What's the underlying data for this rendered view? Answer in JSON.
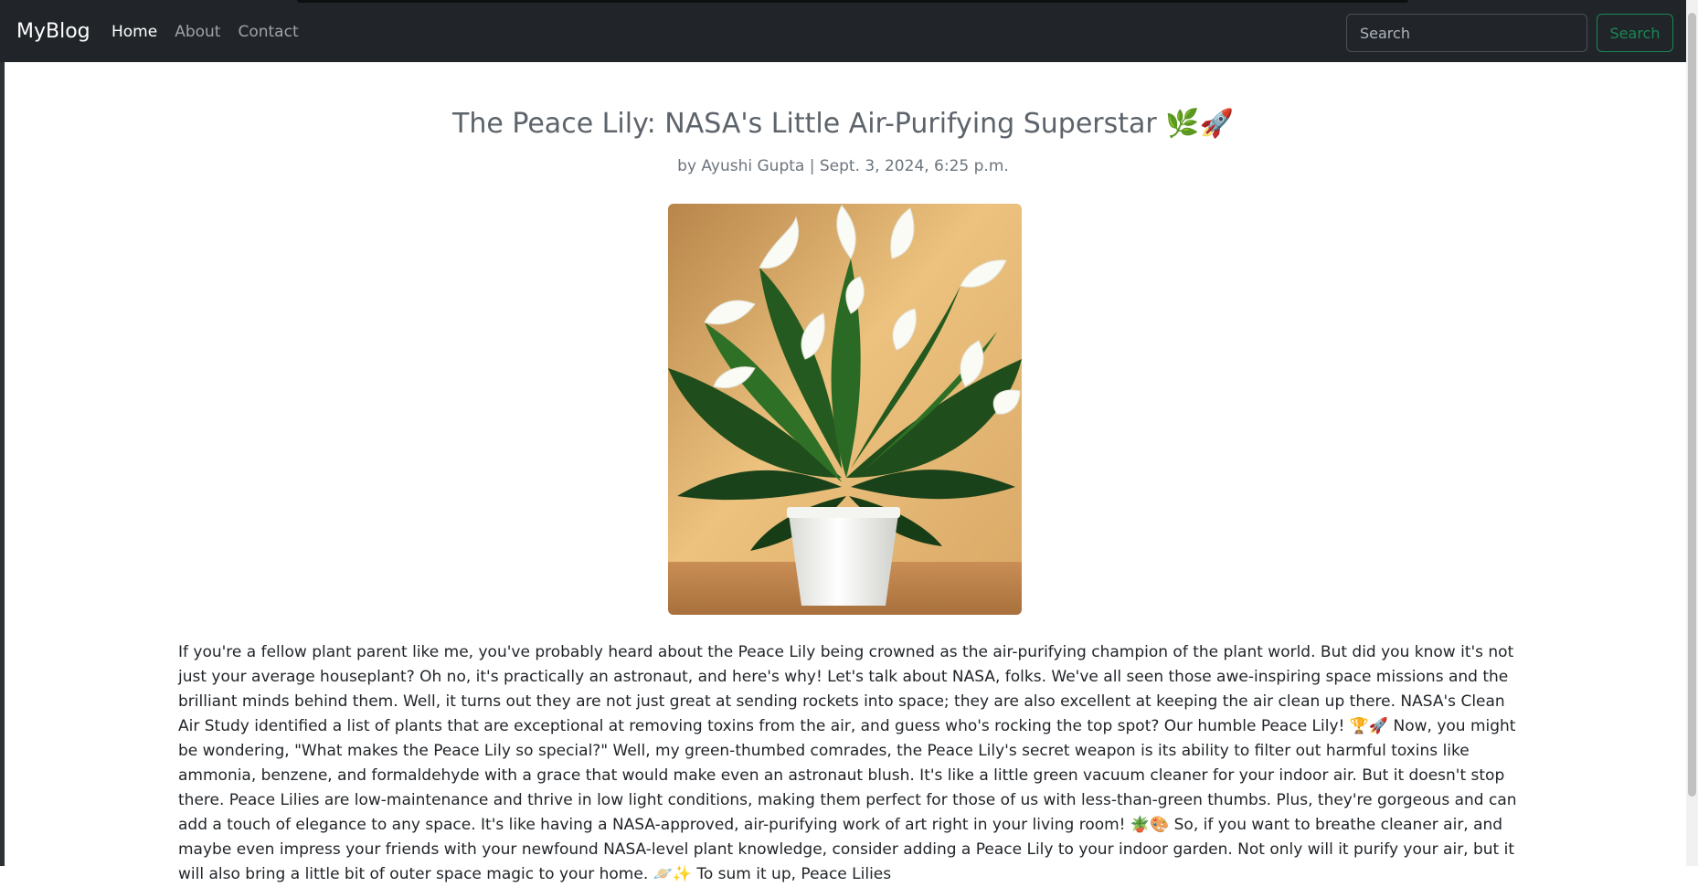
{
  "navbar": {
    "brand": "MyBlog",
    "links": [
      {
        "label": "Home",
        "active": true
      },
      {
        "label": "About",
        "active": false
      },
      {
        "label": "Contact",
        "active": false
      }
    ],
    "search": {
      "placeholder": "Search",
      "value": "",
      "button_label": "Search"
    }
  },
  "post": {
    "title": "The Peace Lily: NASA's Little Air-Purifying Superstar 🌿🚀",
    "meta": "by Ayushi Gupta | Sept. 3, 2024, 6:25 p.m.",
    "image": {
      "subject": "peace lily in white pot"
    },
    "body": "If you're a fellow plant parent like me, you've probably heard about the Peace Lily being crowned as the air-purifying champion of the plant world. But did you know it's not just your average houseplant? Oh no, it's practically an astronaut, and here's why! Let's talk about NASA, folks. We've all seen those awe-inspiring space missions and the brilliant minds behind them. Well, it turns out they are not just great at sending rockets into space; they are also excellent at keeping the air clean up there. NASA's Clean Air Study identified a list of plants that are exceptional at removing toxins from the air, and guess who's rocking the top spot? Our humble Peace Lily! 🏆🚀 Now, you might be wondering, \"What makes the Peace Lily so special?\" Well, my green-thumbed comrades, the Peace Lily's secret weapon is its ability to filter out harmful toxins like ammonia, benzene, and formaldehyde with a grace that would make even an astronaut blush. It's like a little green vacuum cleaner for your indoor air. But it doesn't stop there. Peace Lilies are low-maintenance and thrive in low light conditions, making them perfect for those of us with less-than-green thumbs. Plus, they're gorgeous and can add a touch of elegance to any space. It's like having a NASA-approved, air-purifying work of art right in your living room! 🪴🎨 So, if you want to breathe cleaner air, and maybe even impress your friends with your newfound NASA-level plant knowledge, consider adding a Peace Lily to your indoor garden. Not only will it purify your air, but it will also bring a little bit of outer space magic to your home. 🪐✨ To sum it up, Peace Lilies"
  },
  "colors": {
    "navbar_bg": "#212529",
    "search_button": "#198754",
    "title": "#5c636a",
    "meta": "#6c757d"
  }
}
